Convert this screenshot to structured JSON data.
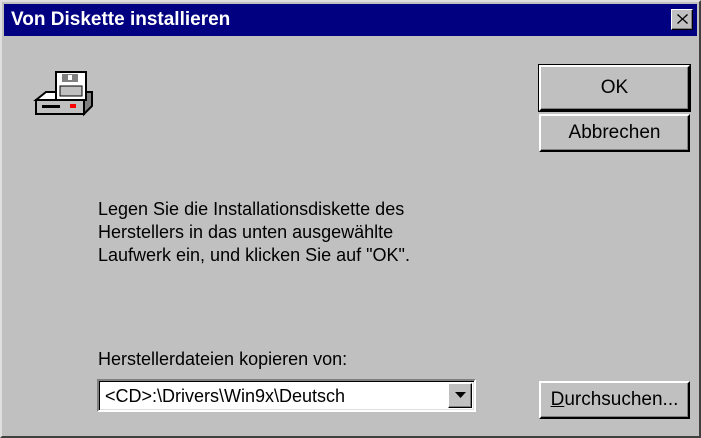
{
  "window": {
    "title": "Von Diskette installieren",
    "close_icon": "close-icon",
    "title_bar_color": "#000080",
    "background_color": "#c0c0c0"
  },
  "icon": {
    "name": "floppy-drive-icon"
  },
  "buttons": {
    "ok_label": "OK",
    "cancel_label": "Abbrechen",
    "browse_mnemonic": "D",
    "browse_rest": "urchsuchen..."
  },
  "instructions": {
    "line1": "Legen Sie die Installationsdiskette des",
    "line2": "Herstellers in das unten ausgewählte",
    "line3": "Laufwerk ein, und klicken Sie auf \"OK\"."
  },
  "copy_from": {
    "label": "Herstellerdateien kopieren von:",
    "value": "<CD>:\\Drivers\\Win9x\\Deutsch",
    "dropdown_icon": "chevron-down-icon"
  }
}
